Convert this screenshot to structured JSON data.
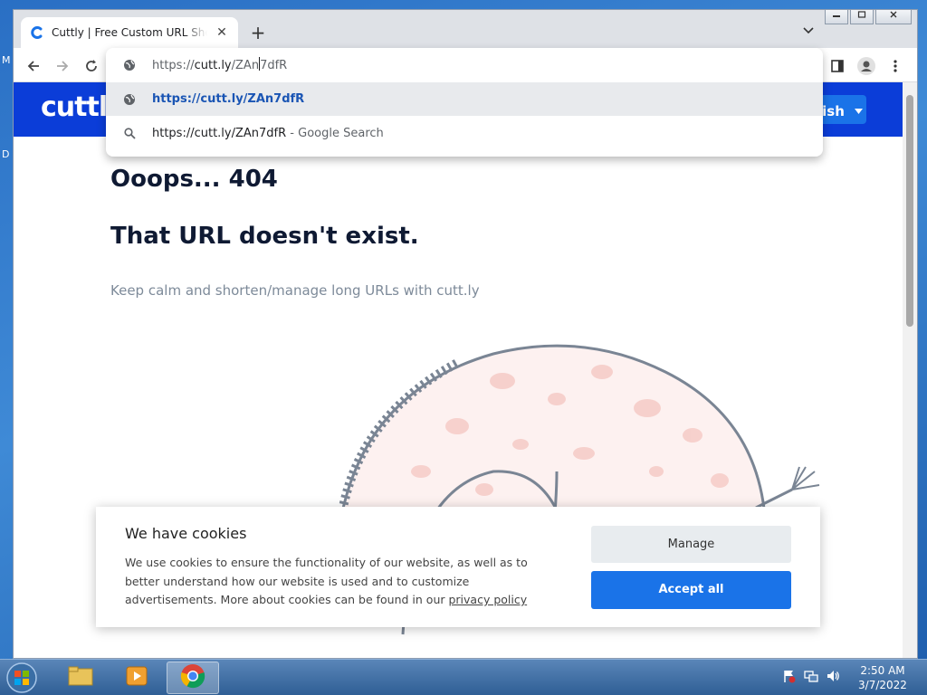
{
  "desktop": {
    "icon_labels": [
      "M",
      "D"
    ]
  },
  "browser": {
    "tab_title": "Cuttly | Free Custom URL Shortener",
    "new_tab_symbol": "+",
    "tab_close_symbol": "✕",
    "omnibox": {
      "input_prefix": "https://",
      "input_host": "cutt.ly",
      "input_path_before_caret": "/ZAn",
      "input_path_after_caret": "7dfR",
      "suggestion_url": "https://cutt.ly/ZAn7dfR",
      "search_query": "https://cutt.ly/ZAn7dfR",
      "search_suffix": " - Google Search"
    }
  },
  "page": {
    "logo": "cuttly",
    "language_button": "lish",
    "error_title": "Ooops... 404",
    "error_subtitle": "That URL doesn't exist.",
    "error_text": "Keep calm and shorten/manage long URLs with cutt.ly"
  },
  "cookie": {
    "title": "We have cookies",
    "text": "We use cookies to ensure the functionality of our website, as well as to better understand how our website is used and to customize advertisements. More about cookies can be found in our ",
    "link": "privacy policy",
    "manage_label": "Manage",
    "accept_label": "Accept all"
  },
  "taskbar": {
    "time": "2:50 AM",
    "date": "3/7/2022"
  },
  "colors": {
    "header_blue": "#0b3dd8",
    "accent_blue": "#1a73e8",
    "heading_dark": "#0f1a33"
  }
}
